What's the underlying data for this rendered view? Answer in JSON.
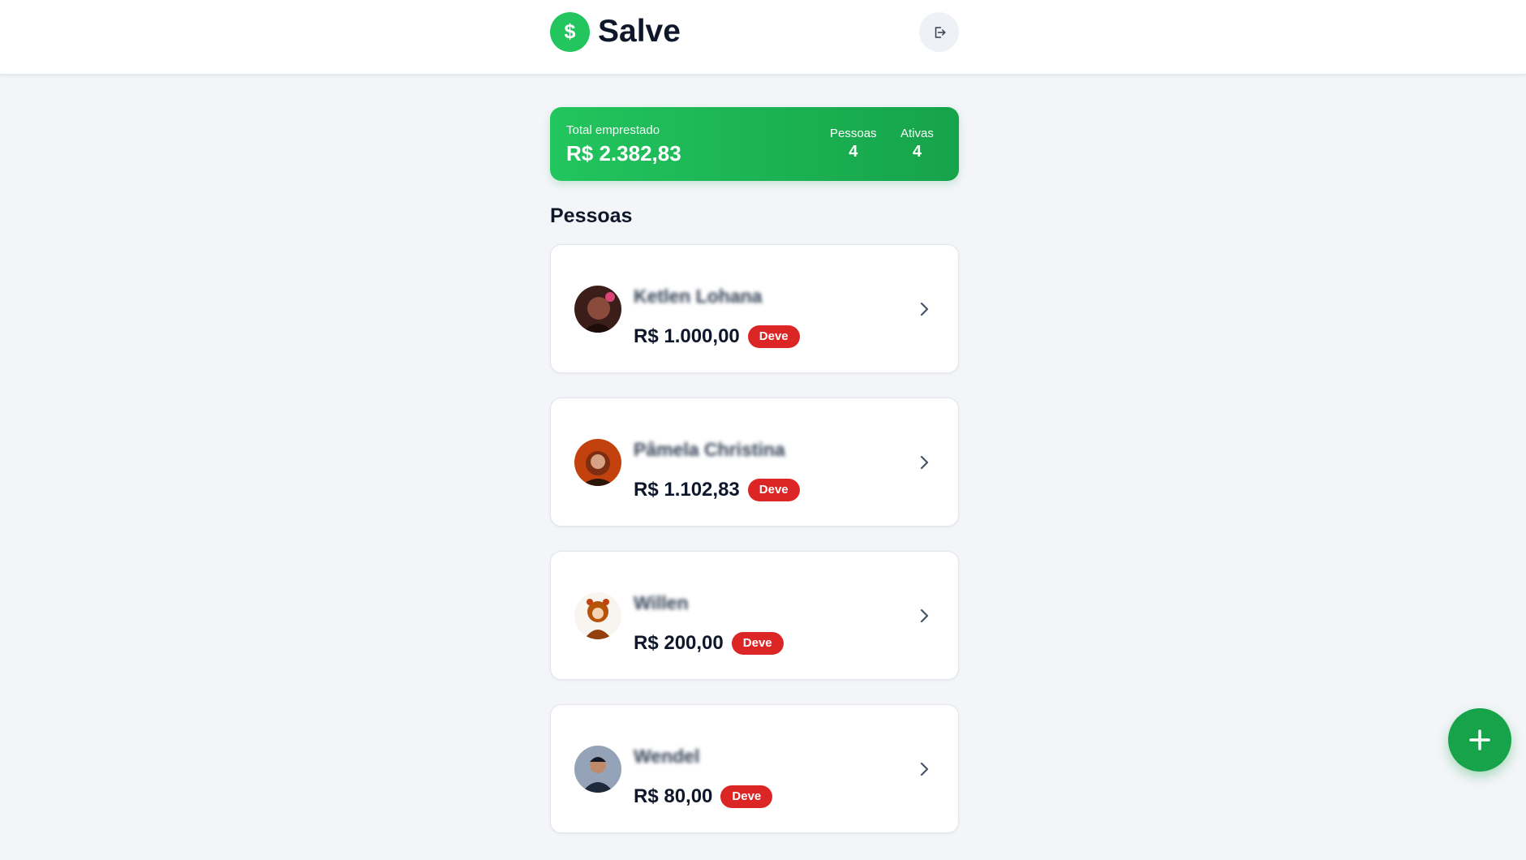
{
  "header": {
    "logo_symbol": "$",
    "title": "Salve",
    "logout_icon": "logout-icon"
  },
  "summary": {
    "label": "Total emprestado",
    "value": "R$ 2.382,83",
    "stats": [
      {
        "label": "Pessoas",
        "value": "4"
      },
      {
        "label": "Ativas",
        "value": "4"
      }
    ]
  },
  "people_section": {
    "title": "Pessoas",
    "items": [
      {
        "name": "Ketlen Lohana",
        "amount": "R$ 1.000,00",
        "status": "Deve"
      },
      {
        "name": "Pâmela Christina",
        "amount": "R$ 1.102,83",
        "status": "Deve"
      },
      {
        "name": "Willen",
        "amount": "R$ 200,00",
        "status": "Deve"
      },
      {
        "name": "Wendel",
        "amount": "R$ 80,00",
        "status": "Deve"
      }
    ]
  },
  "fab": {
    "icon": "plus-icon"
  },
  "colors": {
    "brand_green": "#22c55e",
    "badge_red": "#dc2626",
    "background": "#f3f5f8"
  }
}
